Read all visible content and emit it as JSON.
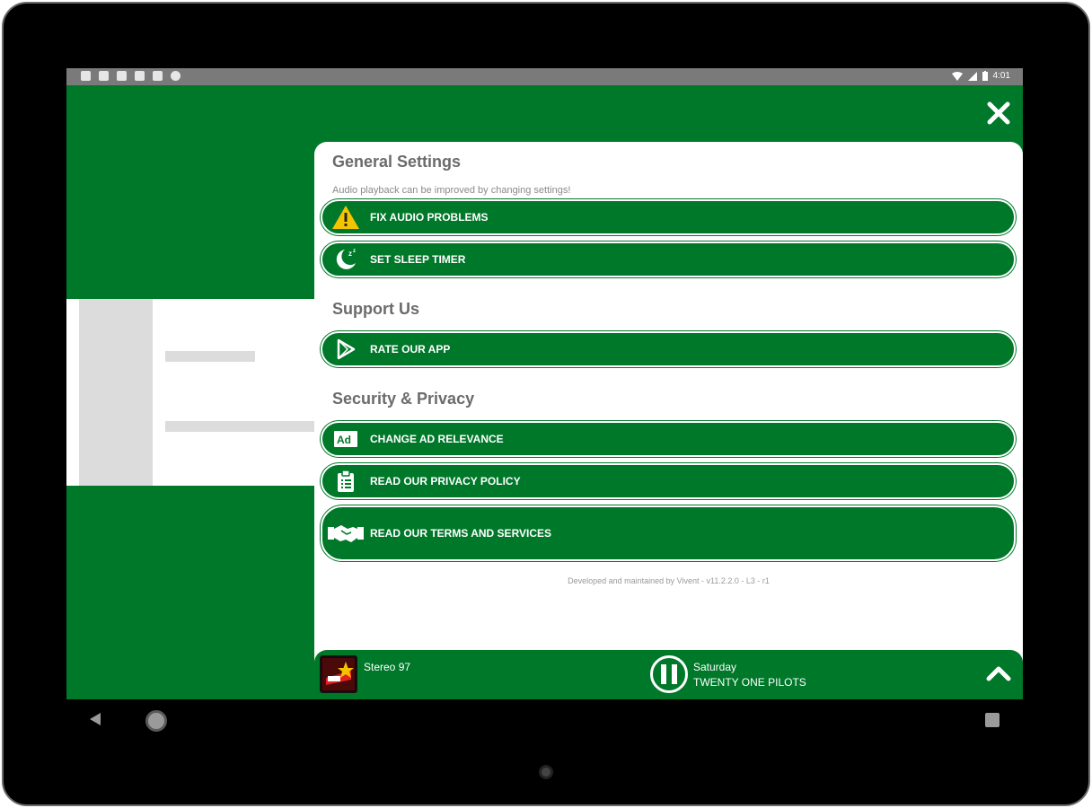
{
  "status_bar": {
    "time": "4:01"
  },
  "header": {
    "close_icon": "close-icon"
  },
  "general": {
    "title": "General Settings",
    "subtitle": "Audio playback can be improved by changing settings!",
    "items": [
      {
        "label": "FIX AUDIO PROBLEMS",
        "icon": "warning-icon"
      },
      {
        "label": "SET SLEEP TIMER",
        "icon": "moon-sleep-icon"
      }
    ]
  },
  "support": {
    "title": "Support Us",
    "items": [
      {
        "label": "RATE OUR APP",
        "icon": "play-store-icon"
      }
    ]
  },
  "security": {
    "title": "Security & Privacy",
    "items": [
      {
        "label": "CHANGE AD RELEVANCE",
        "icon": "ad-icon"
      },
      {
        "label": "READ OUR PRIVACY POLICY",
        "icon": "clipboard-icon"
      },
      {
        "label": "READ OUR TERMS AND SERVICES",
        "icon": "handshake-icon"
      }
    ]
  },
  "footer": {
    "note": "Developed and maintained by Vivent - v11.2.2.0 - L3 - r1"
  },
  "player": {
    "station": "Stereo 97",
    "line1": "Saturday",
    "line2": "TWENTY ONE PILOTS"
  },
  "colors": {
    "brand_green": "#00782a",
    "warning_yellow": "#f5c400"
  }
}
